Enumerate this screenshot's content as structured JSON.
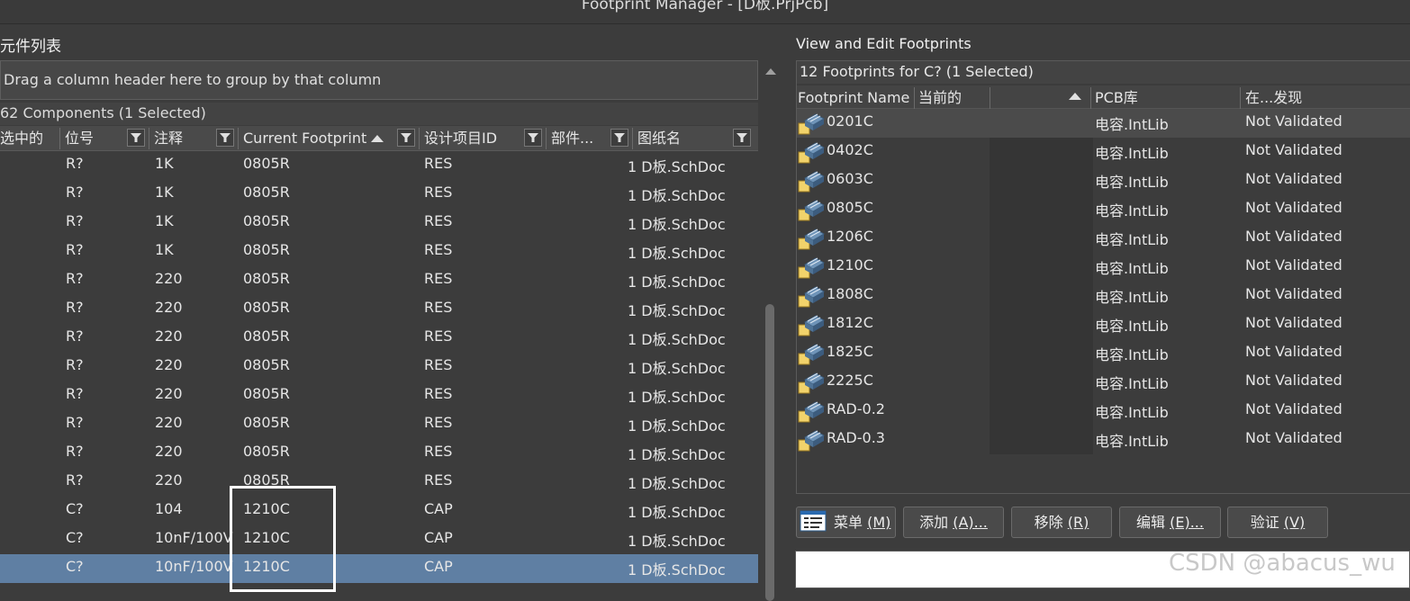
{
  "window": {
    "title": "Footprint Manager - [D板.PrjPcb]"
  },
  "left": {
    "title": "元件列表",
    "group_hint": "Drag a column header here to group by that column",
    "count": "62 Components (1 Selected)",
    "headers": {
      "selected": "选中的",
      "designator": "位号",
      "comment": "注释",
      "footprint": "Current Footprint",
      "design_id": "设计项目ID",
      "part": "部件...",
      "sheet": "图纸名"
    },
    "rows": [
      {
        "des": "R?",
        "comment": "1K",
        "fp": "0805R",
        "id": "RES",
        "sheet": "1 D板.SchDoc",
        "selected": false
      },
      {
        "des": "R?",
        "comment": "1K",
        "fp": "0805R",
        "id": "RES",
        "sheet": "1 D板.SchDoc",
        "selected": false
      },
      {
        "des": "R?",
        "comment": "1K",
        "fp": "0805R",
        "id": "RES",
        "sheet": "1 D板.SchDoc",
        "selected": false
      },
      {
        "des": "R?",
        "comment": "1K",
        "fp": "0805R",
        "id": "RES",
        "sheet": "1 D板.SchDoc",
        "selected": false
      },
      {
        "des": "R?",
        "comment": "220",
        "fp": "0805R",
        "id": "RES",
        "sheet": "1 D板.SchDoc",
        "selected": false
      },
      {
        "des": "R?",
        "comment": "220",
        "fp": "0805R",
        "id": "RES",
        "sheet": "1 D板.SchDoc",
        "selected": false
      },
      {
        "des": "R?",
        "comment": "220",
        "fp": "0805R",
        "id": "RES",
        "sheet": "1 D板.SchDoc",
        "selected": false
      },
      {
        "des": "R?",
        "comment": "220",
        "fp": "0805R",
        "id": "RES",
        "sheet": "1 D板.SchDoc",
        "selected": false
      },
      {
        "des": "R?",
        "comment": "220",
        "fp": "0805R",
        "id": "RES",
        "sheet": "1 D板.SchDoc",
        "selected": false
      },
      {
        "des": "R?",
        "comment": "220",
        "fp": "0805R",
        "id": "RES",
        "sheet": "1 D板.SchDoc",
        "selected": false
      },
      {
        "des": "R?",
        "comment": "220",
        "fp": "0805R",
        "id": "RES",
        "sheet": "1 D板.SchDoc",
        "selected": false
      },
      {
        "des": "R?",
        "comment": "220",
        "fp": "0805R",
        "id": "RES",
        "sheet": "1 D板.SchDoc",
        "selected": false
      },
      {
        "des": "C?",
        "comment": "104",
        "fp": "1210C",
        "id": "CAP",
        "sheet": "1 D板.SchDoc",
        "selected": false
      },
      {
        "des": "C?",
        "comment": "10nF/100V",
        "fp": "1210C",
        "id": "CAP",
        "sheet": "1 D板.SchDoc",
        "selected": false
      },
      {
        "des": "C?",
        "comment": "10nF/100V",
        "fp": "1210C",
        "id": "CAP",
        "sheet": "1 D板.SchDoc",
        "selected": true
      }
    ]
  },
  "right": {
    "title": "View and Edit Footprints",
    "count": "12 Footprints for C? (1 Selected)",
    "headers": {
      "name": "Footprint Name",
      "current": "当前的",
      "lib": "PCB库",
      "found": "在...发现"
    },
    "rows": [
      {
        "name": "0201C",
        "lib": "电容.IntLib",
        "found": "Not Validated",
        "selected": true
      },
      {
        "name": "0402C",
        "lib": "电容.IntLib",
        "found": "Not Validated",
        "selected": false
      },
      {
        "name": "0603C",
        "lib": "电容.IntLib",
        "found": "Not Validated",
        "selected": false
      },
      {
        "name": "0805C",
        "lib": "电容.IntLib",
        "found": "Not Validated",
        "selected": false
      },
      {
        "name": "1206C",
        "lib": "电容.IntLib",
        "found": "Not Validated",
        "selected": false
      },
      {
        "name": "1210C",
        "lib": "电容.IntLib",
        "found": "Not Validated",
        "selected": false
      },
      {
        "name": "1808C",
        "lib": "电容.IntLib",
        "found": "Not Validated",
        "selected": false
      },
      {
        "name": "1812C",
        "lib": "电容.IntLib",
        "found": "Not Validated",
        "selected": false
      },
      {
        "name": "1825C",
        "lib": "电容.IntLib",
        "found": "Not Validated",
        "selected": false
      },
      {
        "name": "2225C",
        "lib": "电容.IntLib",
        "found": "Not Validated",
        "selected": false
      },
      {
        "name": "RAD-0.2",
        "lib": "电容.IntLib",
        "found": "Not Validated",
        "selected": false
      },
      {
        "name": "RAD-0.3",
        "lib": "电容.IntLib",
        "found": "Not Validated",
        "selected": false
      }
    ],
    "buttons": {
      "menu": {
        "text": "菜单 ",
        "hot": "(M)"
      },
      "add": {
        "text": "添加 ",
        "hot": "(A)..."
      },
      "remove": {
        "text": "移除 ",
        "hot": "(R)"
      },
      "edit": {
        "text": "编辑 ",
        "hot": "(E)..."
      },
      "validate": {
        "text": "验证 ",
        "hot": "(V)"
      }
    }
  },
  "watermark": "CSDN @abacus_wu",
  "icons": {
    "filter": "filter-icon",
    "sort": "sort-ascending-icon",
    "footprint": "footprint-chip-icon",
    "menu": "menu-list-icon"
  }
}
